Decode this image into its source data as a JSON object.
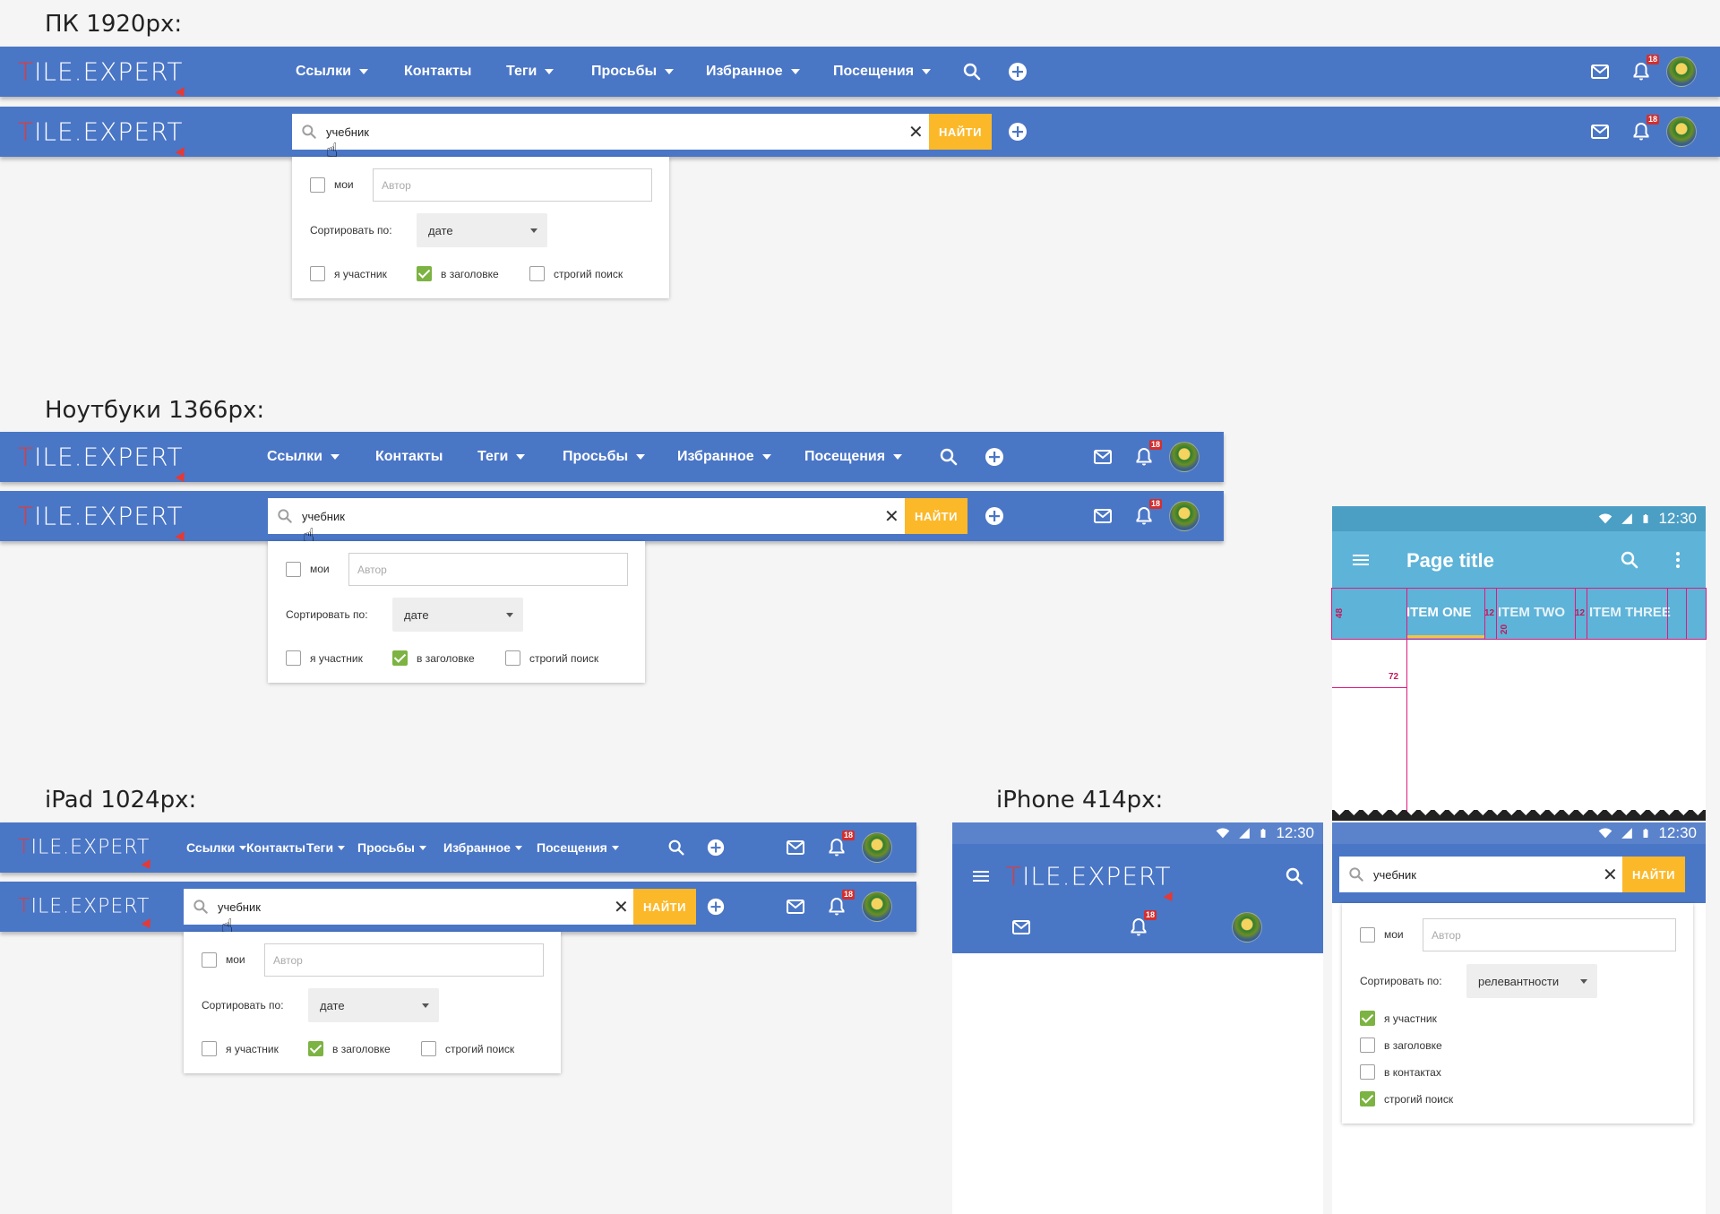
{
  "sections": {
    "pc": "ПК 1920px:",
    "laptop": "Ноутбуки 1366px:",
    "ipad": "iPad 1024px:",
    "iphone": "iPhone 414px:"
  },
  "logo": {
    "first": "T",
    "rest": "ILE.EXPERT"
  },
  "nav": {
    "links": "Ссылки",
    "contacts": "Контакты",
    "tags": "Теги",
    "requests": "Просьбы",
    "favorites": "Избранное",
    "visits": "Посещения"
  },
  "notifications": {
    "count": "18"
  },
  "search": {
    "value": "учебник",
    "find_label": "НАЙТИ",
    "clear": "✕"
  },
  "filters": {
    "mine_label": "мои",
    "author_placeholder": "Автор",
    "sort_label": "Сортировать по:",
    "sort_value": "дате",
    "sort_value_mobile": "релевантности",
    "participant_label": "я участник",
    "in_title_label": "в заголовке",
    "in_contacts_label": "в контактах",
    "strict_label": "строгий поиск"
  },
  "desktop_filter_state": {
    "mine": false,
    "participant": false,
    "in_title": true,
    "strict": false
  },
  "mobile_filter_state": {
    "mine": false,
    "participant": true,
    "in_title": false,
    "in_contacts": false,
    "strict": true
  },
  "android_spec": {
    "time": "12:30",
    "page_title": "Page title",
    "tabs": [
      "ITEM ONE",
      "ITEM TWO",
      "ITEM THREE"
    ],
    "spec_numbers": [
      "48",
      "12",
      "20",
      "12",
      "72"
    ]
  },
  "colors": {
    "header": "#4a76c6",
    "find_button": "#fbb829",
    "checked": "#7cb342",
    "badge": "#d32f2f",
    "spec_appbar": "#5eb3d8",
    "keyline": "#e0197e"
  },
  "icons": [
    "search-icon",
    "add-circle-icon",
    "mail-icon",
    "bell-icon",
    "avatar",
    "menu-icon",
    "more-vert-icon",
    "wifi-icon",
    "signal-icon",
    "battery-icon",
    "close-icon",
    "hand-cursor-icon"
  ]
}
